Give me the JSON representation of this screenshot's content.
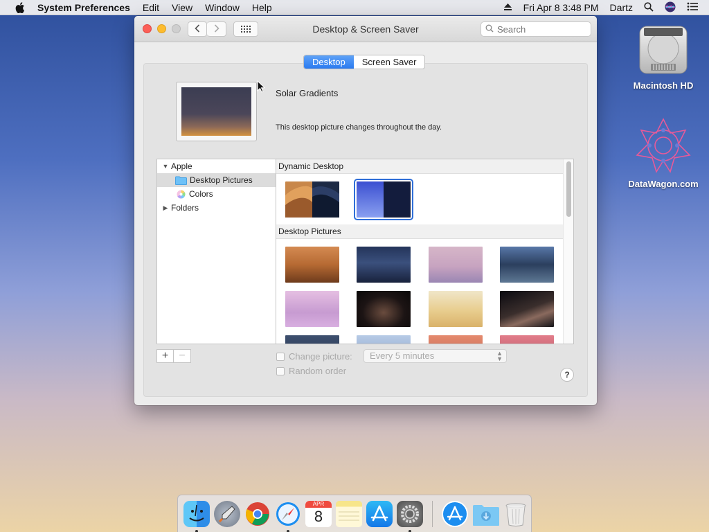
{
  "menubar": {
    "app_name": "System Preferences",
    "menus": [
      "Edit",
      "View",
      "Window",
      "Help"
    ],
    "clock": "Fri Apr 8  3:48 PM",
    "user": "Dartz"
  },
  "desktop_icons": [
    {
      "label": "Macintosh HD",
      "icon": "hard-drive-icon"
    },
    {
      "label": "DataWagon.com",
      "icon": "datawagon-logo-icon"
    }
  ],
  "window": {
    "title": "Desktop & Screen Saver",
    "search_placeholder": "Search",
    "tabs": [
      {
        "label": "Desktop",
        "active": true
      },
      {
        "label": "Screen Saver",
        "active": false
      }
    ],
    "current_picture": {
      "name": "Solar Gradients",
      "description": "This desktop picture changes throughout the day."
    },
    "sidebar": {
      "groups": [
        {
          "label": "Apple",
          "expanded": true,
          "children": [
            "Desktop Pictures",
            "Colors"
          ]
        },
        {
          "label": "Folders",
          "expanded": false
        }
      ],
      "selected": "Desktop Pictures"
    },
    "gallery": {
      "sections": [
        {
          "title": "Dynamic Desktop",
          "count": 2,
          "selected_index": 1
        },
        {
          "title": "Desktop Pictures",
          "count": 12
        }
      ]
    },
    "controls": {
      "add": "+",
      "remove": "−",
      "change_picture_label": "Change picture:",
      "interval": "Every 5 minutes",
      "random_order_label": "Random order",
      "help": "?"
    }
  },
  "dock": {
    "apps": [
      "Finder",
      "Launchpad",
      "Chrome",
      "Safari",
      "Calendar",
      "Notes",
      "App Store",
      "System Preferences"
    ],
    "recent": [
      "App Store",
      "Downloads",
      "Trash"
    ],
    "calendar": {
      "month": "APR",
      "day": "8"
    }
  },
  "colors": {
    "accent": "#2a7af0",
    "close": "#fc5f57",
    "minimize": "#fdbc2e",
    "zoom": "#c8c8c8"
  }
}
